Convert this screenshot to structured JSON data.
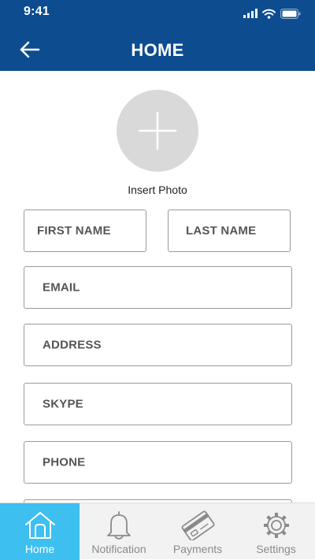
{
  "status_bar": {
    "time": "9:41",
    "icons": [
      "signal-icon",
      "wifi-icon",
      "battery-icon"
    ]
  },
  "header": {
    "title": "HOME",
    "back_icon": "back-arrow-icon"
  },
  "photo": {
    "label": "Insert Photo",
    "icon": "plus-icon"
  },
  "form": {
    "first_name_placeholder": "FIRST NAME",
    "last_name_placeholder": "LAST NAME",
    "email_placeholder": "EMAIL",
    "address_placeholder": "ADDRESS",
    "skype_placeholder": "SKYPE",
    "phone_placeholder": "PHONE"
  },
  "tabbar": {
    "active": "home",
    "tabs": [
      {
        "id": "home",
        "label": "Home",
        "icon": "home-icon"
      },
      {
        "id": "notification",
        "label": "Notification",
        "icon": "bell-icon"
      },
      {
        "id": "payments",
        "label": "Payments",
        "icon": "credit-card-icon"
      },
      {
        "id": "settings",
        "label": "Settings",
        "icon": "gear-icon"
      }
    ]
  },
  "colors": {
    "header_bg": "#0c4c8f",
    "active_tab_bg": "#3dbff0",
    "tabbar_bg": "#f2f2f2",
    "photo_circle": "#d9d9d9"
  }
}
